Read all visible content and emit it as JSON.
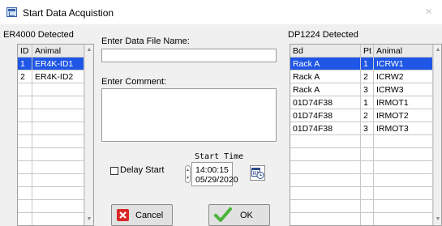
{
  "window": {
    "title": "Start Data Acquistion"
  },
  "left_panel": {
    "label": "ER4000 Detected",
    "columns": [
      "ID",
      "Animal"
    ],
    "rows": [
      {
        "id": "1",
        "animal": "ER4K-ID1",
        "selected": true
      },
      {
        "id": "2",
        "animal": "ER4K-ID2",
        "selected": false
      }
    ]
  },
  "middle": {
    "file_label": "Enter Data File Name:",
    "file_value": "",
    "comment_label": "Enter Comment:",
    "comment_value": "",
    "delay_label": "Delay Start",
    "delay_checked": false,
    "start_time_label": "Start Time",
    "start_time": "14:00:15",
    "start_date": "05/29/2020"
  },
  "right_panel": {
    "label": "DP1224 Detected",
    "columns": [
      "Bd",
      "Pt",
      "Animal"
    ],
    "rows": [
      {
        "bd": "Rack A",
        "pt": "1",
        "animal": "ICRW1",
        "selected": true
      },
      {
        "bd": "Rack A",
        "pt": "2",
        "animal": "ICRW2",
        "selected": false
      },
      {
        "bd": "Rack A",
        "pt": "3",
        "animal": "ICRW3",
        "selected": false
      },
      {
        "bd": "01D74F38",
        "pt": "1",
        "animal": "IRMOT1",
        "selected": false
      },
      {
        "bd": "01D74F38",
        "pt": "2",
        "animal": "IRMOT2",
        "selected": false
      },
      {
        "bd": "01D74F38",
        "pt": "3",
        "animal": "IRMOT3",
        "selected": false
      }
    ]
  },
  "buttons": {
    "cancel": "Cancel",
    "ok": "OK"
  },
  "icons": {
    "app": "app-window-icon",
    "close": "close-icon",
    "cancel": "red-x-icon",
    "ok": "green-check-icon",
    "calendar": "calendar-clock-icon"
  },
  "colors": {
    "selection": "#1f56e6",
    "cancel_icon": "#d92626",
    "ok_icon": "#4bb33c"
  }
}
